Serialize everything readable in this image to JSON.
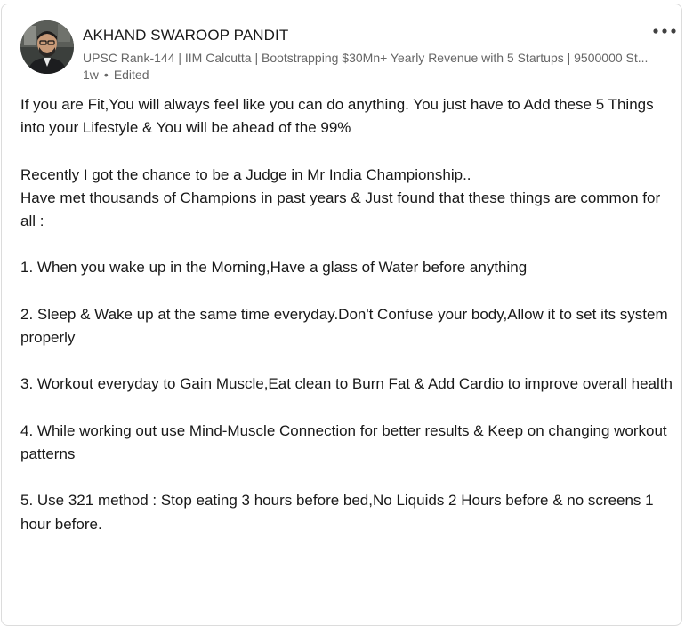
{
  "post": {
    "author": {
      "name": "AKHAND SWAROOP PANDIT",
      "headline": "UPSC Rank-144 | IIM Calcutta | Bootstrapping $30Mn+ Yearly Revenue with 5 Startups | 9500000 St...",
      "time": "1w",
      "separator": "•",
      "edited": "Edited",
      "avatar_icon": "profile-photo-icon"
    },
    "menu_icon": "more-options-icon",
    "paragraphs": [
      "If you are Fit,You will always feel like you can do anything. You just have to Add these 5 Things into your Lifestyle & You will be ahead of the 99%",
      "Recently I got the chance to be a Judge in Mr India Championship..",
      "Have met thousands of Champions in past years & Just found that these things are common for all :",
      "1. When you wake up in the Morning,Have a glass of Water before anything",
      "2. Sleep & Wake up at the same time everyday.Don't Confuse your body,Allow it to set its system properly",
      "3. Workout everyday to Gain Muscle,Eat clean to Burn Fat & Add Cardio to improve overall health",
      "4. While working out use Mind-Muscle Connection for better results & Keep on changing workout patterns",
      "5. Use 321 method : Stop eating 3 hours before bed,No Liquids 2 Hours before & no screens 1 hour before."
    ]
  }
}
